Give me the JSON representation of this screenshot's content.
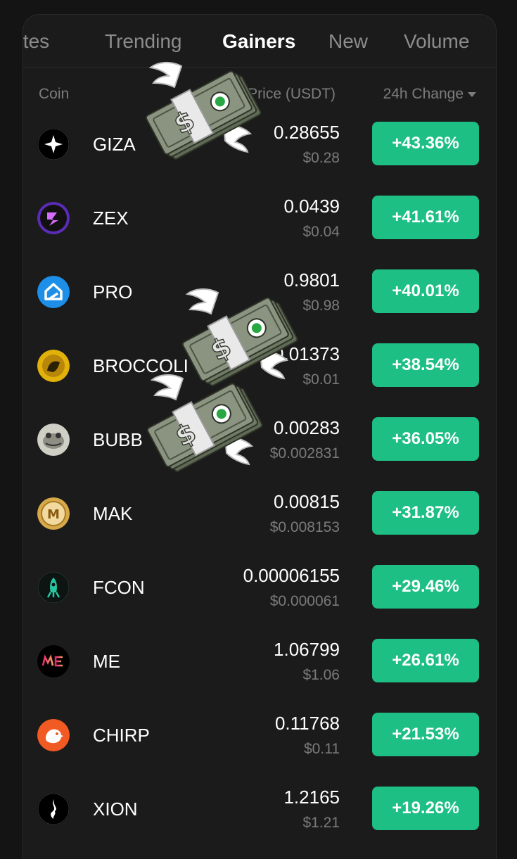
{
  "tabs": [
    {
      "label": "Favorites",
      "active": false
    },
    {
      "label": "Trending",
      "active": false
    },
    {
      "label": "Gainers",
      "active": true
    },
    {
      "label": "New",
      "active": false
    },
    {
      "label": "Volume",
      "active": false
    }
  ],
  "header": {
    "coin": "Coin",
    "price": "Price (USDT)",
    "change": "24h Change"
  },
  "colors": {
    "positive": "#1dbf84",
    "background": "#1b1b1b",
    "muted_text": "#7a7a7a"
  },
  "coins": [
    {
      "symbol": "GIZA",
      "price": "0.28655",
      "usd": "$0.28",
      "change": "+43.36%",
      "icon": "giza-star-icon"
    },
    {
      "symbol": "ZEX",
      "price": "0.0439",
      "usd": "$0.04",
      "change": "+41.61%",
      "icon": "zex-bolt-icon"
    },
    {
      "symbol": "PRO",
      "price": "0.9801",
      "usd": "$0.98",
      "change": "+40.01%",
      "icon": "pro-house-icon"
    },
    {
      "symbol": "BROCCOLI",
      "price": "0.01373",
      "usd": "$0.01",
      "change": "+38.54%",
      "icon": "broccoli-dog-icon"
    },
    {
      "symbol": "BUBB",
      "price": "0.00283",
      "usd": "$0.002831",
      "change": "+36.05%",
      "icon": "bubb-frog-icon"
    },
    {
      "symbol": "MAK",
      "price": "0.00815",
      "usd": "$0.008153",
      "change": "+31.87%",
      "icon": "mak-coin-icon"
    },
    {
      "symbol": "FCON",
      "price": "0.00006155",
      "usd": "$0.000061",
      "change": "+29.46%",
      "icon": "fcon-rocket-icon"
    },
    {
      "symbol": "ME",
      "price": "1.06799",
      "usd": "$1.06",
      "change": "+26.61%",
      "icon": "me-wordmark-icon"
    },
    {
      "symbol": "CHIRP",
      "price": "0.11768",
      "usd": "$0.11",
      "change": "+21.53%",
      "icon": "chirp-bird-icon"
    },
    {
      "symbol": "XION",
      "price": "1.2165",
      "usd": "$1.21",
      "change": "+19.26%",
      "icon": "xion-flame-icon"
    }
  ],
  "stickers": [
    "money-with-wings-emoji",
    "money-with-wings-emoji",
    "money-with-wings-emoji"
  ]
}
